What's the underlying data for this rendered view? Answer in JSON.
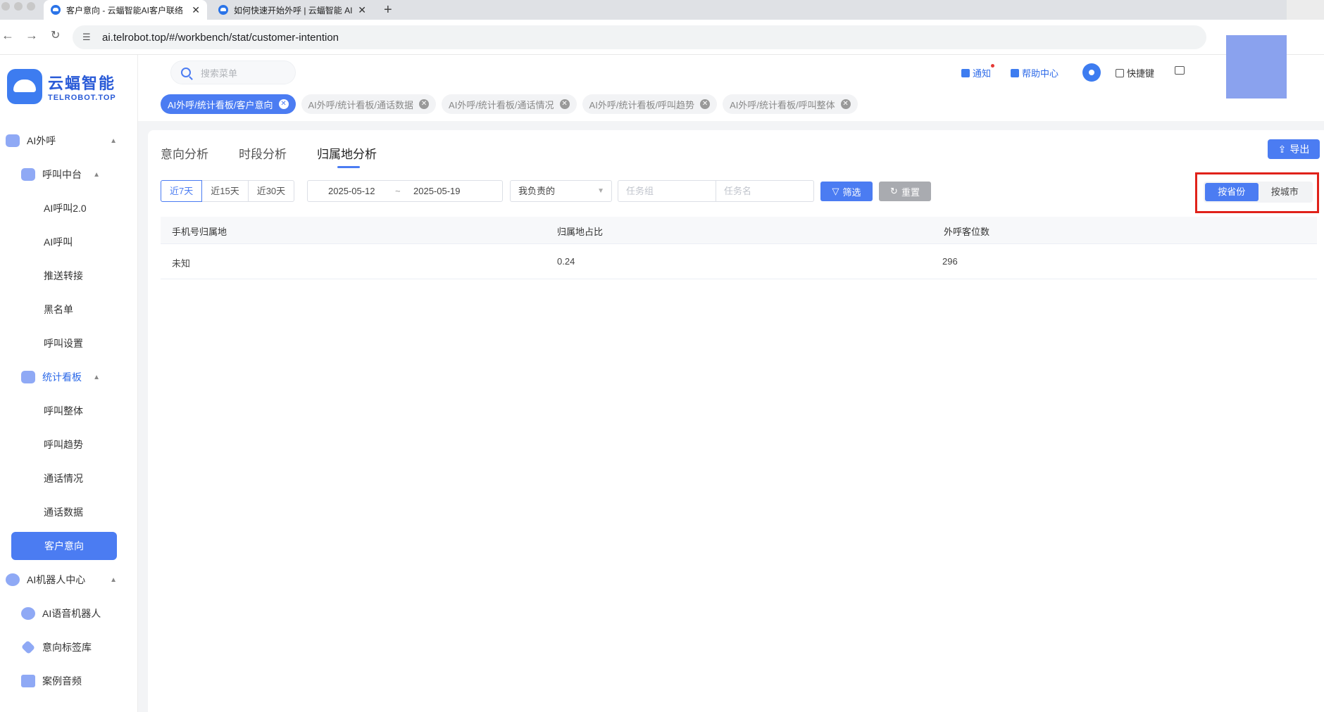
{
  "browser": {
    "tabs": [
      {
        "title": "客户意向 - 云蝠智能AI客户联络",
        "active": true
      },
      {
        "title": "如何快速开始外呼 | 云蝠智能 AI",
        "active": false
      }
    ],
    "url": "ai.telrobot.top/#/workbench/stat/customer-intention"
  },
  "logo": {
    "cn": "云蝠智能",
    "en": "TELROBOT.TOP"
  },
  "sidebar": {
    "items": [
      {
        "label": "AI外呼"
      },
      {
        "label": "呼叫中台"
      },
      {
        "label": "AI呼叫2.0"
      },
      {
        "label": "AI呼叫"
      },
      {
        "label": "推送转接"
      },
      {
        "label": "黑名单"
      },
      {
        "label": "呼叫设置"
      },
      {
        "label": "统计看板"
      },
      {
        "label": "呼叫整体"
      },
      {
        "label": "呼叫趋势"
      },
      {
        "label": "通话情况"
      },
      {
        "label": "通话数据"
      },
      {
        "label": "客户意向"
      },
      {
        "label": "AI机器人中心"
      },
      {
        "label": "AI语音机器人"
      },
      {
        "label": "意向标签库"
      },
      {
        "label": "案例音频"
      }
    ]
  },
  "header": {
    "search_placeholder": "搜索菜单",
    "notify": "通知",
    "help": "帮助中心",
    "shortcut": "快捷键"
  },
  "open_tags": [
    {
      "label": "AI外呼/统计看板/客户意向",
      "active": true
    },
    {
      "label": "AI外呼/统计看板/通话数据",
      "active": false
    },
    {
      "label": "AI外呼/统计看板/通话情况",
      "active": false
    },
    {
      "label": "AI外呼/统计看板/呼叫趋势",
      "active": false
    },
    {
      "label": "AI外呼/统计看板/呼叫整体",
      "active": false
    }
  ],
  "page_tabs": [
    {
      "label": "意向分析"
    },
    {
      "label": "时段分析"
    },
    {
      "label": "归属地分析",
      "active": true
    }
  ],
  "export_label": "导出",
  "filters": {
    "ranges": [
      "近7天",
      "近15天",
      "近30天"
    ],
    "selected_range": "近7天",
    "start_date": "2025-05-12",
    "date_sep": "~",
    "end_date": "2025-05-19",
    "owner": "我负责的",
    "task_group_placeholder": "任务组",
    "task_name_placeholder": "任务名",
    "filter_label": "筛选",
    "reset_label": "重置"
  },
  "toggle": {
    "province": "按省份",
    "city": "按城市",
    "selected": "按省份"
  },
  "table": {
    "headers": [
      "手机号归属地",
      "归属地占比",
      "外呼客位数"
    ],
    "rows": [
      [
        "未知",
        "0.24",
        "296"
      ]
    ]
  },
  "colors": {
    "accent": "#4b7cf2",
    "highlight_border": "#e0221a"
  }
}
